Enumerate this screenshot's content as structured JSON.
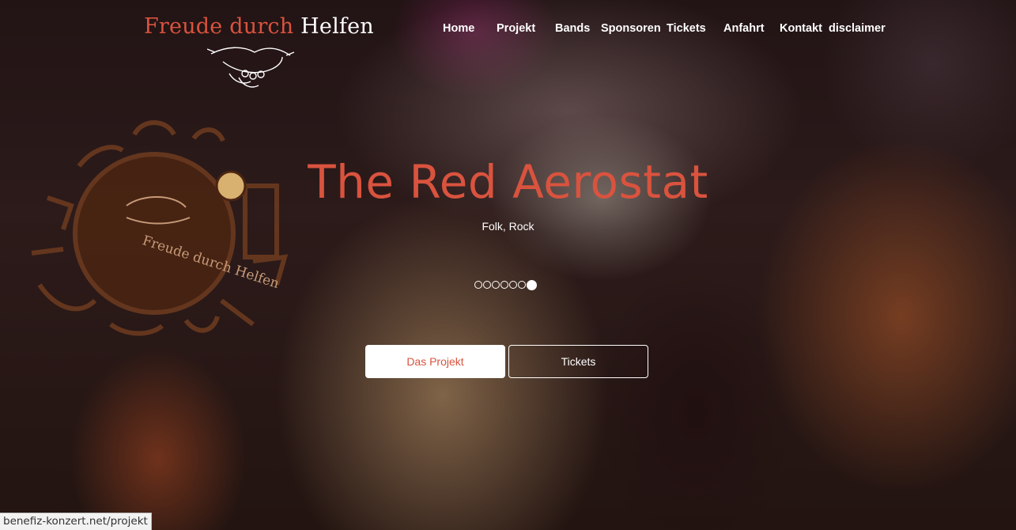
{
  "logo": {
    "part1": "Freude durch",
    "part2": "Helfen"
  },
  "emblem": {
    "text": "Freude durch Helfen"
  },
  "nav": [
    {
      "label": "Home"
    },
    {
      "label": "Projekt"
    },
    {
      "label": "Bands"
    },
    {
      "label": "Sponsoren"
    },
    {
      "label": "Tickets"
    },
    {
      "label": "Anfahrt"
    },
    {
      "label": "Kontakt"
    },
    {
      "label": "disclaimer"
    }
  ],
  "slide": {
    "title": "The Red Aerostat",
    "genre": "Folk, Rock"
  },
  "slider": {
    "count": 7,
    "active_index": 6
  },
  "buttons": {
    "primary": "Das Projekt",
    "secondary": "Tickets"
  },
  "status_bar": {
    "url": "benefiz-konzert.net/projekt"
  },
  "colors": {
    "accent": "#d9533e",
    "text": "#ffffff"
  }
}
